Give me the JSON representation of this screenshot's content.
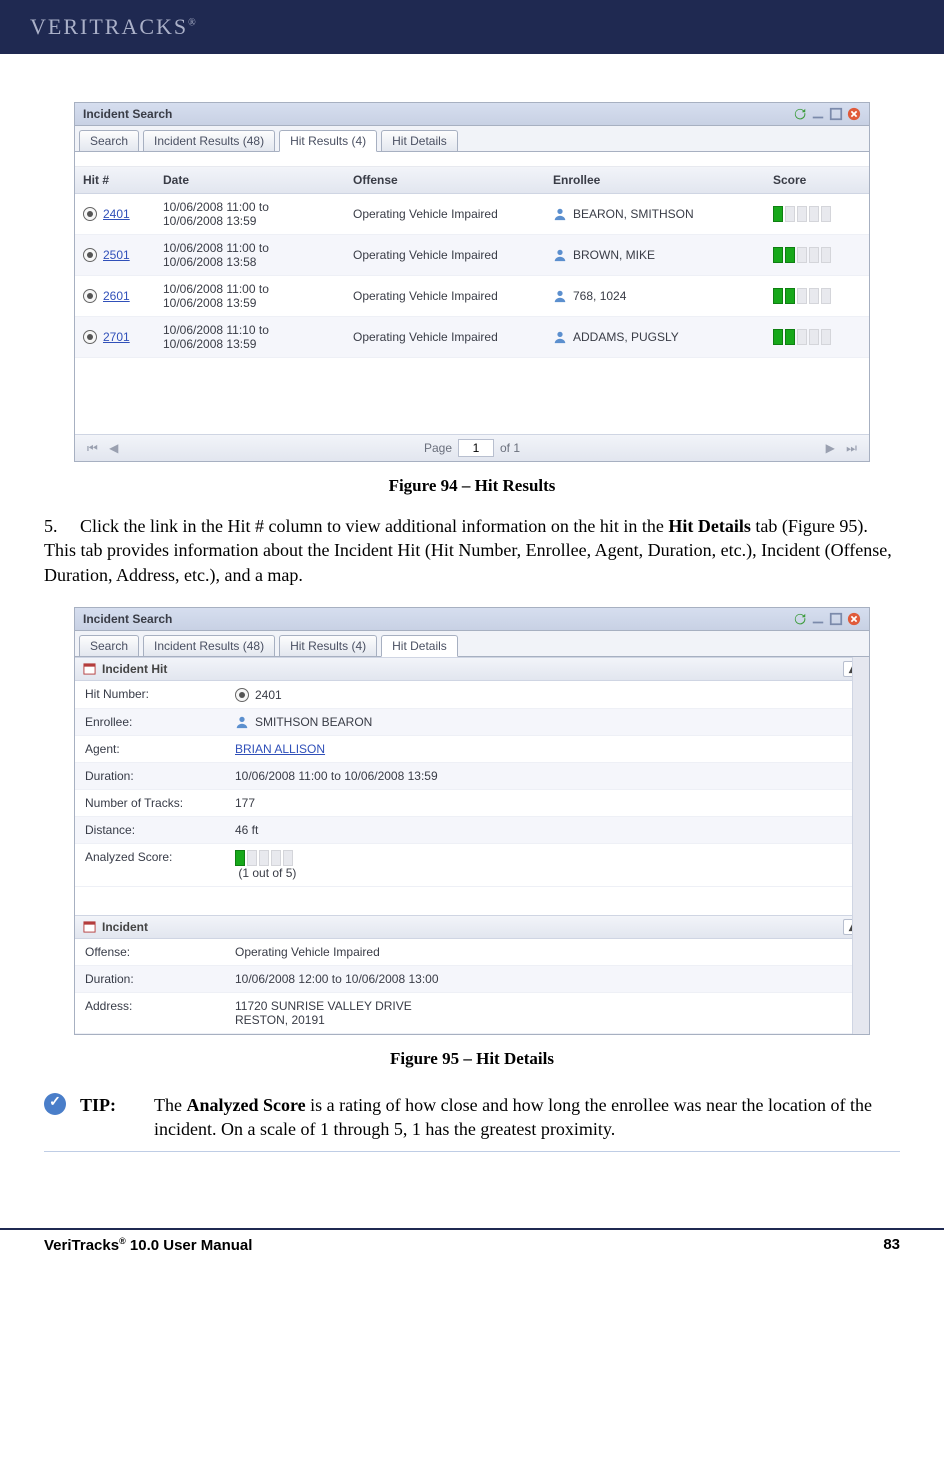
{
  "header": {
    "brand": "VeriTracks",
    "reg": "®"
  },
  "panel1": {
    "title": "Incident Search",
    "tabs": [
      {
        "label": "Search",
        "active": false
      },
      {
        "label": "Incident Results (48)",
        "active": false
      },
      {
        "label": "Hit Results (4)",
        "active": true
      },
      {
        "label": "Hit Details",
        "active": false
      }
    ],
    "columns": [
      "Hit #",
      "Date",
      "Offense",
      "Enrollee",
      "Score"
    ],
    "rows": [
      {
        "hit": "2401",
        "date": "10/06/2008 11:00 to 10/06/2008 13:59",
        "offense": "Operating Vehicle Impaired",
        "enrollee": "BEARON, SMITHSON",
        "score": 1
      },
      {
        "hit": "2501",
        "date": "10/06/2008 11:00 to 10/06/2008 13:58",
        "offense": "Operating Vehicle Impaired",
        "enrollee": "BROWN, MIKE",
        "score": 2
      },
      {
        "hit": "2601",
        "date": "10/06/2008 11:00 to 10/06/2008 13:59",
        "offense": "Operating Vehicle Impaired",
        "enrollee": "768, 1024",
        "score": 2
      },
      {
        "hit": "2701",
        "date": "10/06/2008 11:10 to 10/06/2008 13:59",
        "offense": "Operating Vehicle Impaired",
        "enrollee": "ADDAMS, PUGSLY",
        "score": 2
      }
    ],
    "pager": {
      "page_label": "Page",
      "page_value": "1",
      "of_label": "of 1"
    }
  },
  "caption1": "Figure 94 – Hit Results",
  "step5": {
    "num": "5.",
    "text_before": "Click the link in the Hit # column to view additional information on the hit in the ",
    "bold": "Hit Details",
    "text_after": " tab (Figure 95). This tab provides information about the Incident Hit (Hit Number, Enrollee, Agent, Duration, etc.), Incident (Offense, Duration, Address, etc.), and a map."
  },
  "panel2": {
    "title": "Incident Search",
    "tabs": [
      {
        "label": "Search",
        "active": false
      },
      {
        "label": "Incident Results (48)",
        "active": false
      },
      {
        "label": "Hit Results (4)",
        "active": false
      },
      {
        "label": "Hit Details",
        "active": true
      }
    ],
    "section1": {
      "title": "Incident Hit",
      "rows": [
        {
          "k": "Hit Number:",
          "v": "2401",
          "icon": "radio"
        },
        {
          "k": "Enrollee:",
          "v": "SMITHSON BEARON",
          "icon": "person"
        },
        {
          "k": "Agent:",
          "v": "BRIAN ALLISON",
          "link": true
        },
        {
          "k": "Duration:",
          "v": "10/06/2008 11:00 to 10/06/2008 13:59"
        },
        {
          "k": "Number of Tracks:",
          "v": "177"
        },
        {
          "k": "Distance:",
          "v": "46 ft"
        },
        {
          "k": "Analyzed Score:",
          "score": 1,
          "score_text": "(1 out of 5)"
        }
      ]
    },
    "section2": {
      "title": "Incident",
      "rows": [
        {
          "k": "Offense:",
          "v": "Operating Vehicle Impaired"
        },
        {
          "k": "Duration:",
          "v": "10/06/2008 12:00 to 10/06/2008 13:00"
        },
        {
          "k": "Address:",
          "v": "11720 SUNRISE VALLEY DRIVE\nRESTON, 20191"
        }
      ]
    }
  },
  "caption2": "Figure 95 – Hit Details",
  "tip": {
    "label": "TIP:",
    "text_before": "The ",
    "bold": "Analyzed Score",
    "text_after": " is a rating of how close and how long the enrollee was near the location of the incident. On a scale of 1 through 5, 1 has the greatest proximity."
  },
  "footer": {
    "left_before": "VeriTracks",
    "left_sup": "®",
    "left_after": " 10.0 User Manual",
    "right": "83"
  }
}
